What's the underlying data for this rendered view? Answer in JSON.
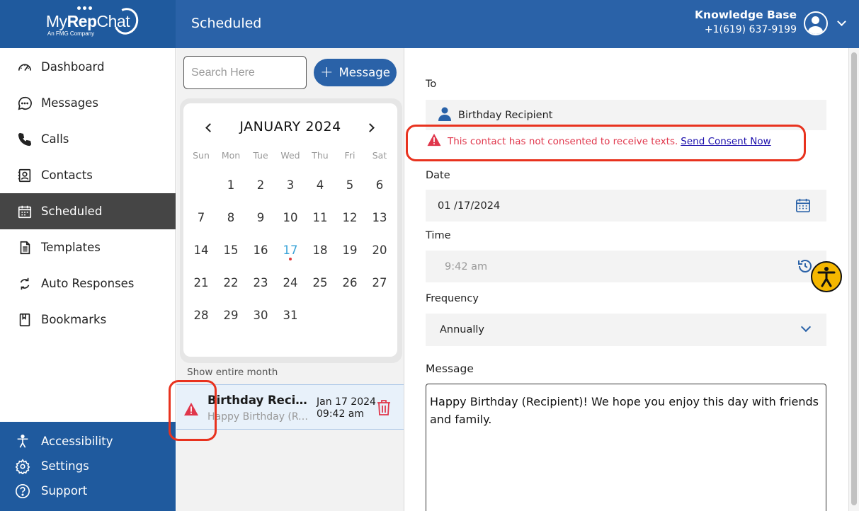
{
  "brand": {
    "logo_prefix": "My",
    "logo_bold": "Rep",
    "logo_suffix": "Chat",
    "logo_sub": "An FMG Company"
  },
  "sidebar": {
    "items": [
      {
        "label": "Dashboard",
        "icon": "gauge-icon"
      },
      {
        "label": "Messages",
        "icon": "chat-bubble-icon"
      },
      {
        "label": "Calls",
        "icon": "phone-icon"
      },
      {
        "label": "Contacts",
        "icon": "contact-card-icon"
      },
      {
        "label": "Scheduled",
        "icon": "calendar-icon",
        "active": true
      },
      {
        "label": "Templates",
        "icon": "document-icon"
      },
      {
        "label": "Auto Responses",
        "icon": "refresh-icon"
      },
      {
        "label": "Bookmarks",
        "icon": "bookmark-icon"
      }
    ],
    "bottom": [
      {
        "label": "Accessibility",
        "icon": "accessibility-icon"
      },
      {
        "label": "Settings",
        "icon": "gear-icon"
      },
      {
        "label": "Support",
        "icon": "help-icon"
      }
    ]
  },
  "header": {
    "title": "Scheduled",
    "user_name": "Knowledge Base",
    "user_phone": "+1(619) 637-9199"
  },
  "list_panel": {
    "search_placeholder": "Search Here",
    "message_button": "Message",
    "show_month": "Show entire month"
  },
  "calendar": {
    "month_label": "JANUARY 2024",
    "weekdays": [
      "Sun",
      "Mon",
      "Tue",
      "Wed",
      "Thu",
      "Fri",
      "Sat"
    ],
    "first_weekday_index": 1,
    "days_in_month": 31,
    "today": 17
  },
  "scheduled_item": {
    "name": "Birthday Recipient",
    "preview": "Happy Birthday (Recipient)! We hope you enjoy this day with friends and family.",
    "date": "Jan 17 2024",
    "time": "09:42 am"
  },
  "form": {
    "to_label": "To",
    "to_value": "Birthday Recipient",
    "consent_warning": "This contact has not consented to receive texts.",
    "consent_link": "Send Consent Now",
    "date_label": "Date",
    "date_value": "01 /17/2024",
    "time_label": "Time",
    "time_value": "9:42 am",
    "frequency_label": "Frequency",
    "frequency_value": "Annually",
    "message_label": "Message",
    "message_value": "Happy Birthday (Recipient)! We hope you enjoy this day with friends and family."
  },
  "colors": {
    "brand_blue": "#1f5a9e",
    "header_blue": "#2a62a8",
    "active_nav": "#454545",
    "warning_red": "#e0364b",
    "highlight_red": "#e8321e",
    "accessibility_yellow": "#f5b700"
  }
}
